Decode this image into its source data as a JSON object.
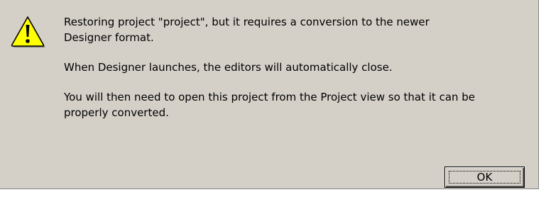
{
  "dialog": {
    "icon": "warning-icon",
    "messages": [
      "Restoring project \"project\", but it requires a conversion to the newer\nDesigner format.",
      "When Designer launches, the editors will automatically close.",
      "You will then need to open this project from the Project view so that it can be\nproperly converted."
    ],
    "ok_label": "OK"
  },
  "colors": {
    "dialog_background": "#d4d0c8",
    "warning_fill": "#ffff00",
    "text": "#000000"
  }
}
